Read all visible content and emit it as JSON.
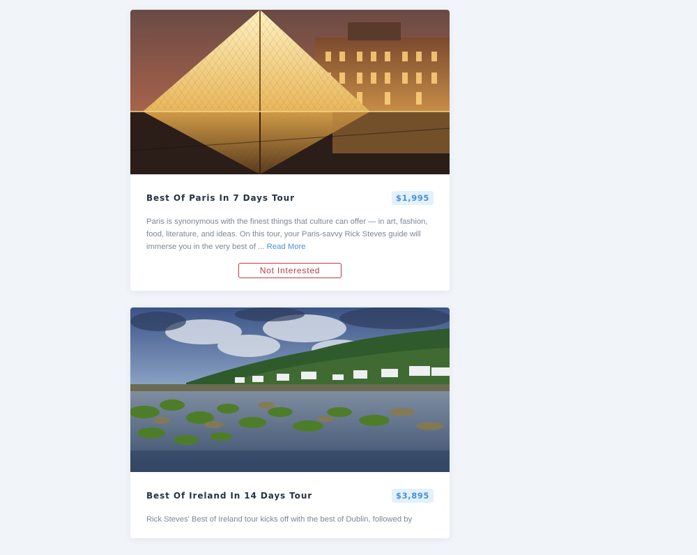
{
  "tours": [
    {
      "title": "Best Of Paris In 7 Days Tour",
      "price": "$1,995",
      "description": "Paris is synonymous with the finest things that culture can offer — in art, fashion, food, literature, and ideas. On this tour, your Paris-savvy Rick Steves guide will immerse you in the very best of ...",
      "read_more": "Read More",
      "button": "Not Interested"
    },
    {
      "title": "Best Of Ireland In 14 Days Tour",
      "price": "$3,895",
      "description": "Rick Steves' Best of Ireland tour kicks off with the best of Dublin, followed by"
    }
  ]
}
